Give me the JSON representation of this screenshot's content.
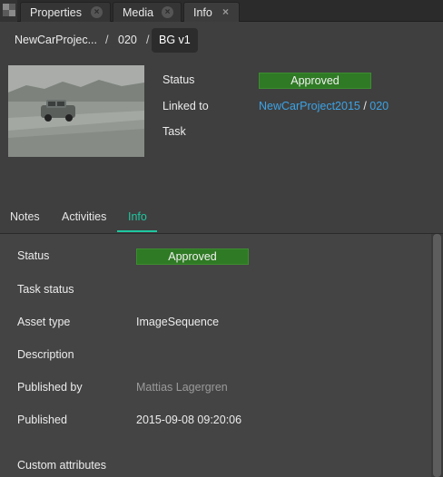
{
  "tabs": [
    {
      "label": "Properties"
    },
    {
      "label": "Media"
    },
    {
      "label": "Info"
    }
  ],
  "tab_close_glyph": "×",
  "breadcrumb": {
    "project": "NewCarProjec...",
    "sep1": "/",
    "shot": "020",
    "sep2": "/",
    "version": "BG v1"
  },
  "summary": {
    "status_label": "Status",
    "status_value": "Approved",
    "linked_label": "Linked to",
    "linked_project": "NewCarProject2015",
    "linked_sep": " / ",
    "linked_shot": "020",
    "task_label": "Task"
  },
  "subtabs": [
    {
      "label": "Notes"
    },
    {
      "label": "Activities"
    },
    {
      "label": "Info"
    }
  ],
  "info": {
    "status_label": "Status",
    "status_value": "Approved",
    "task_status_label": "Task status",
    "asset_type_label": "Asset type",
    "asset_type_value": "ImageSequence",
    "description_label": "Description",
    "published_by_label": "Published by",
    "published_by_value": "Mattias Lagergren",
    "published_label": "Published",
    "published_value": "2015-09-08 09:20:06",
    "custom_attributes_label": "Custom attributes"
  },
  "colors": {
    "approved": "#2f7a24",
    "link": "#3ca3e6",
    "accent": "#1ec8a0"
  }
}
